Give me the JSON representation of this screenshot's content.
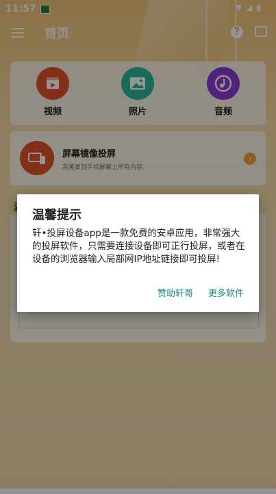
{
  "status_bar": {
    "time": "11:57",
    "battery_icon": "battery-charging-icon"
  },
  "app_bar": {
    "title": "首页"
  },
  "media_buttons": [
    {
      "label": "视频",
      "color": "#e4542a",
      "icon": "video-icon"
    },
    {
      "label": "照片",
      "color": "#2bb79a",
      "icon": "photo-icon"
    },
    {
      "label": "音频",
      "color": "#8b3bd6",
      "icon": "music-icon"
    }
  ],
  "mirror": {
    "title": "屏幕镜像投屏",
    "subtitle": "完美复刻手机屏幕上所有内容。"
  },
  "dialog": {
    "title": "温馨提示",
    "body": "轩•投屏设备app是一款免费的安卓应用，非常强大的投屏软件，只需要连接设备即可正行投屏，或者在设备的浏览器输入局部网IP地址链接即可投屏!",
    "buttons": {
      "sponsor": "赞助轩哥",
      "more": "更多软件"
    }
  },
  "colors": {
    "accent": "#1b8a7a",
    "brand": "#f0c37a"
  }
}
